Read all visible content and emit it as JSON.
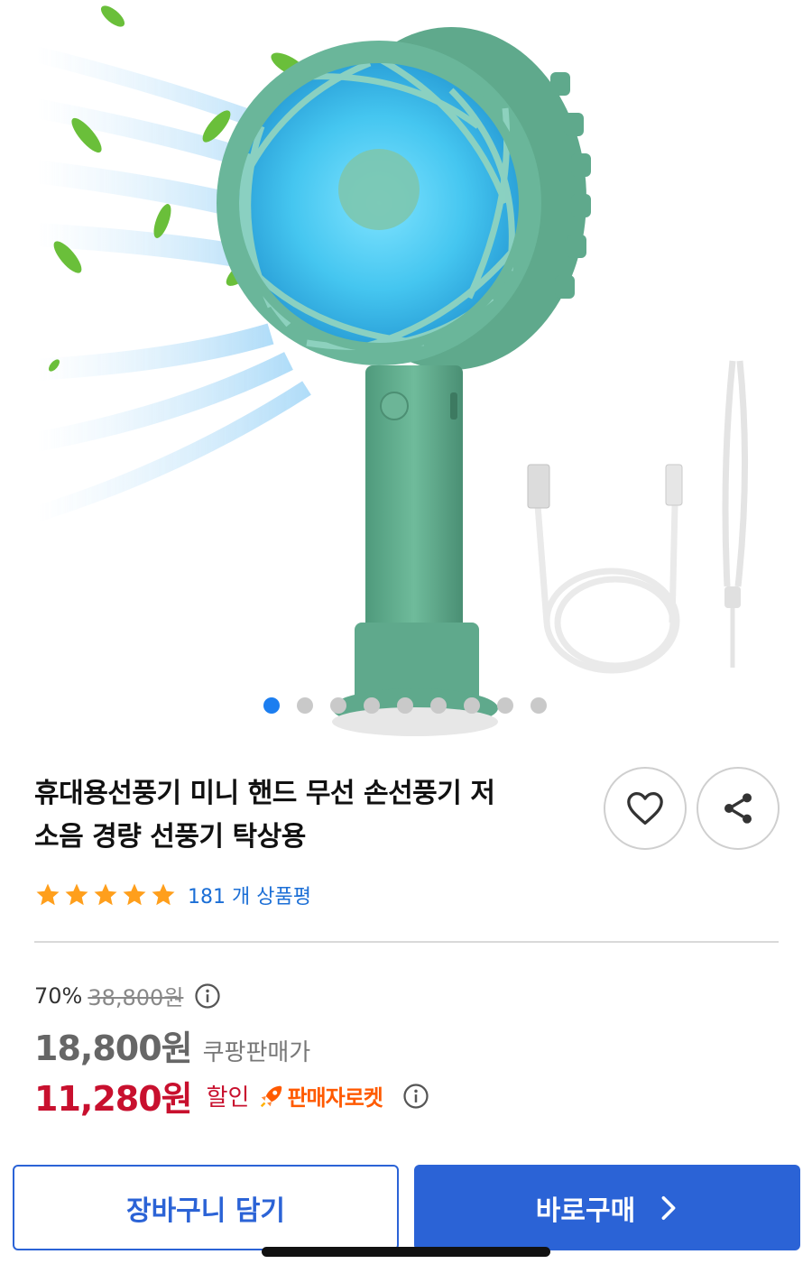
{
  "product": {
    "title_line1": "휴대용선풍기 미니 핸드 무선 손선풍기 저",
    "title_line2": "소음 경량 선풍기 탁상용",
    "image_alt": "mini handheld fan with usb cable and strap"
  },
  "gallery": {
    "total_images": 9,
    "active_index": 0
  },
  "rating": {
    "stars": 5,
    "review_count_text": "181 개 상품평"
  },
  "pricing": {
    "discount_rate": "70%",
    "original_price": "38,800원",
    "coupang_price": "18,800원",
    "coupang_price_label": "쿠팡판매가",
    "final_price": "11,280원",
    "final_price_label": "할인",
    "seller_rocket_label": "판매자로켓"
  },
  "actions": {
    "add_to_cart": "장바구니 담기",
    "buy_now": "바로구매"
  },
  "icons": {
    "wishlist": "heart-icon",
    "share": "share-icon",
    "info": "info-icon",
    "star": "star-icon",
    "rocket": "rocket-icon",
    "chevron": "chevron-right-icon"
  },
  "colors": {
    "accent_blue": "#2b63d6",
    "link_blue": "#1c6fd6",
    "sale_red": "#c8102e",
    "rocket_orange": "#ff5a00",
    "star_orange": "#ff9f1c",
    "fan_green": "#5fa98c"
  }
}
